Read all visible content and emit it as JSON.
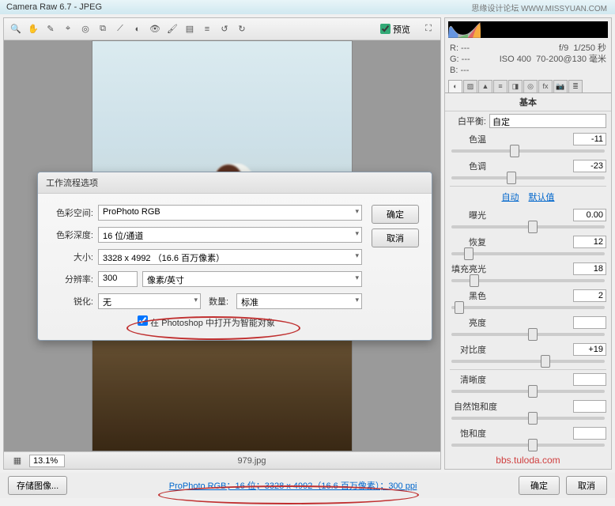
{
  "window": {
    "title": "Camera Raw 6.7 - JPEG"
  },
  "watermark_top": "思缘设计论坛  WWW.MISSYUAN.COM",
  "toolbar": {
    "preview_label": "预览",
    "preview_checked": true
  },
  "canvas": {
    "zoom": "13.1%",
    "filename": "979.jpg"
  },
  "dialog": {
    "title": "工作流程选项",
    "fields": {
      "color_space_label": "色彩空间:",
      "color_space_value": "ProPhoto RGB",
      "depth_label": "色彩深度:",
      "depth_value": "16 位/通道",
      "size_label": "大小:",
      "size_value": "3328 x 4992 （16.6 百万像素）",
      "res_label": "分辨率:",
      "res_value": "300",
      "res_unit": "像素/英寸",
      "sharpen_label": "锐化:",
      "sharpen_value": "无",
      "amount_label": "数量:",
      "amount_value": "标准",
      "open_smart_label": "在 Photoshop 中打开为智能对象"
    },
    "buttons": {
      "ok": "确定",
      "cancel": "取消"
    }
  },
  "readout": {
    "r": "R: ---",
    "g": "G: ---",
    "b": "B: ---",
    "aperture": "f/9",
    "shutter": "1/250 秒",
    "iso": "ISO 400",
    "lens": "70-200@130 毫米"
  },
  "basic": {
    "title": "基本",
    "wb_label": "白平衡:",
    "wb_value": "自定",
    "temp_label": "色温",
    "temp_value": "-11",
    "tint_label": "色调",
    "tint_value": "-23",
    "auto": "自动",
    "default": "默认值",
    "exposure_label": "曝光",
    "exposure_value": "0.00",
    "recovery_label": "恢复",
    "recovery_value": "12",
    "fill_label": "填充亮光",
    "fill_value": "18",
    "black_label": "黑色",
    "black_value": "2",
    "brightness_label": "亮度",
    "brightness_value": "",
    "contrast_label": "对比度",
    "contrast_value": "+19",
    "clarity_label": "清晰度",
    "clarity_value": "",
    "vibrance_label": "自然饱和度",
    "vibrance_value": "",
    "saturation_label": "饱和度",
    "saturation_value": ""
  },
  "watermark_red": "bbs.tuloda.com",
  "footer": {
    "save": "存储图像...",
    "link": "ProPhoto RGB；16 位；3328 x 4992（16.6 百万像素）；300 ppi",
    "ok": "确定",
    "cancel": "取消"
  }
}
